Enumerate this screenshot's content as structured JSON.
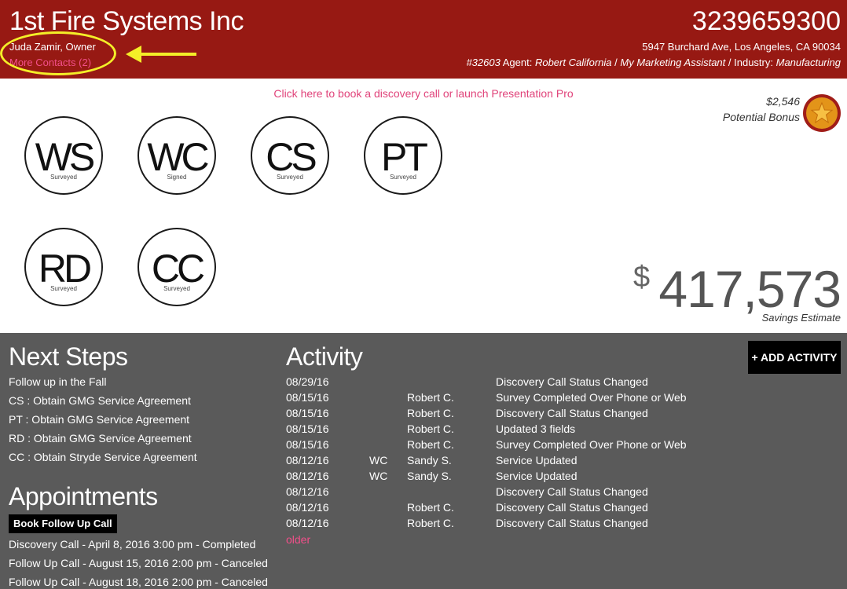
{
  "header": {
    "company": "1st Fire Systems Inc",
    "contact": "Juda Zamir, Owner",
    "more_contacts": "More Contacts (2)",
    "phone": "3239659300",
    "address": "5947 Burchard Ave, Los Angeles, CA 90034",
    "account_id": "#32603",
    "agent_label": "Agent:",
    "agent_name": "Robert California",
    "separator1": "/",
    "assistant": "My Marketing Assistant",
    "industry_label": "/ Industry:",
    "industry": "Manufacturing"
  },
  "main": {
    "discovery_link": "Click here to book a discovery call or launch Presentation Pro",
    "bonus_amount": "$2,546",
    "bonus_label": "Potential Bonus",
    "services": [
      {
        "code": "WS",
        "status": "Surveyed"
      },
      {
        "code": "WC",
        "status": "Signed"
      },
      {
        "code": "CS",
        "status": "Surveyed"
      },
      {
        "code": "PT",
        "status": "Surveyed"
      },
      {
        "code": "RD",
        "status": "Surveyed"
      },
      {
        "code": "CC",
        "status": "Surveyed"
      }
    ],
    "savings_currency": "$",
    "savings_value": "417,573",
    "savings_label": "Savings Estimate"
  },
  "next_steps": {
    "title": "Next Steps",
    "items": [
      "Follow up in the Fall",
      "CS : Obtain GMG Service Agreement",
      "PT : Obtain GMG Service Agreement",
      "RD : Obtain GMG Service Agreement",
      "CC : Obtain Stryde Service Agreement"
    ]
  },
  "appointments": {
    "title": "Appointments",
    "book_button": "Book Follow Up Call",
    "items": [
      "Discovery Call - April 8, 2016 3:00 pm - Completed",
      "Follow Up Call - August 15, 2016 2:00 pm - Canceled",
      "Follow Up Call - August 18, 2016 2:00 pm - Canceled"
    ]
  },
  "activity": {
    "title": "Activity",
    "add_button": "+ ADD ACTIVITY",
    "older_link": "older",
    "rows": [
      {
        "date": "08/29/16",
        "service": "",
        "user": "",
        "description": "Discovery Call Status Changed"
      },
      {
        "date": "08/15/16",
        "service": "",
        "user": "Robert C.",
        "description": "Survey Completed Over Phone or Web"
      },
      {
        "date": "08/15/16",
        "service": "",
        "user": "Robert C.",
        "description": "Discovery Call Status Changed"
      },
      {
        "date": "08/15/16",
        "service": "",
        "user": "Robert C.",
        "description": "Updated 3 fields"
      },
      {
        "date": "08/15/16",
        "service": "",
        "user": "Robert C.",
        "description": "Survey Completed Over Phone or Web"
      },
      {
        "date": "08/12/16",
        "service": "WC",
        "user": "Sandy S.",
        "description": "Service Updated"
      },
      {
        "date": "08/12/16",
        "service": "WC",
        "user": "Sandy S.",
        "description": "Service Updated"
      },
      {
        "date": "08/12/16",
        "service": "",
        "user": "",
        "description": "Discovery Call Status Changed"
      },
      {
        "date": "08/12/16",
        "service": "",
        "user": "Robert C.",
        "description": "Discovery Call Status Changed"
      },
      {
        "date": "08/12/16",
        "service": "",
        "user": "Robert C.",
        "description": "Discovery Call Status Changed"
      }
    ]
  },
  "colors": {
    "header_bg": "#971913",
    "panel_bg": "#5a5a5a",
    "link_pink": "#e0437a",
    "annotation_yellow": "#f4ee28",
    "star_orange": "#e39419"
  },
  "icons": {
    "bonus": "star-icon",
    "annotation": "arrow-left-icon"
  }
}
